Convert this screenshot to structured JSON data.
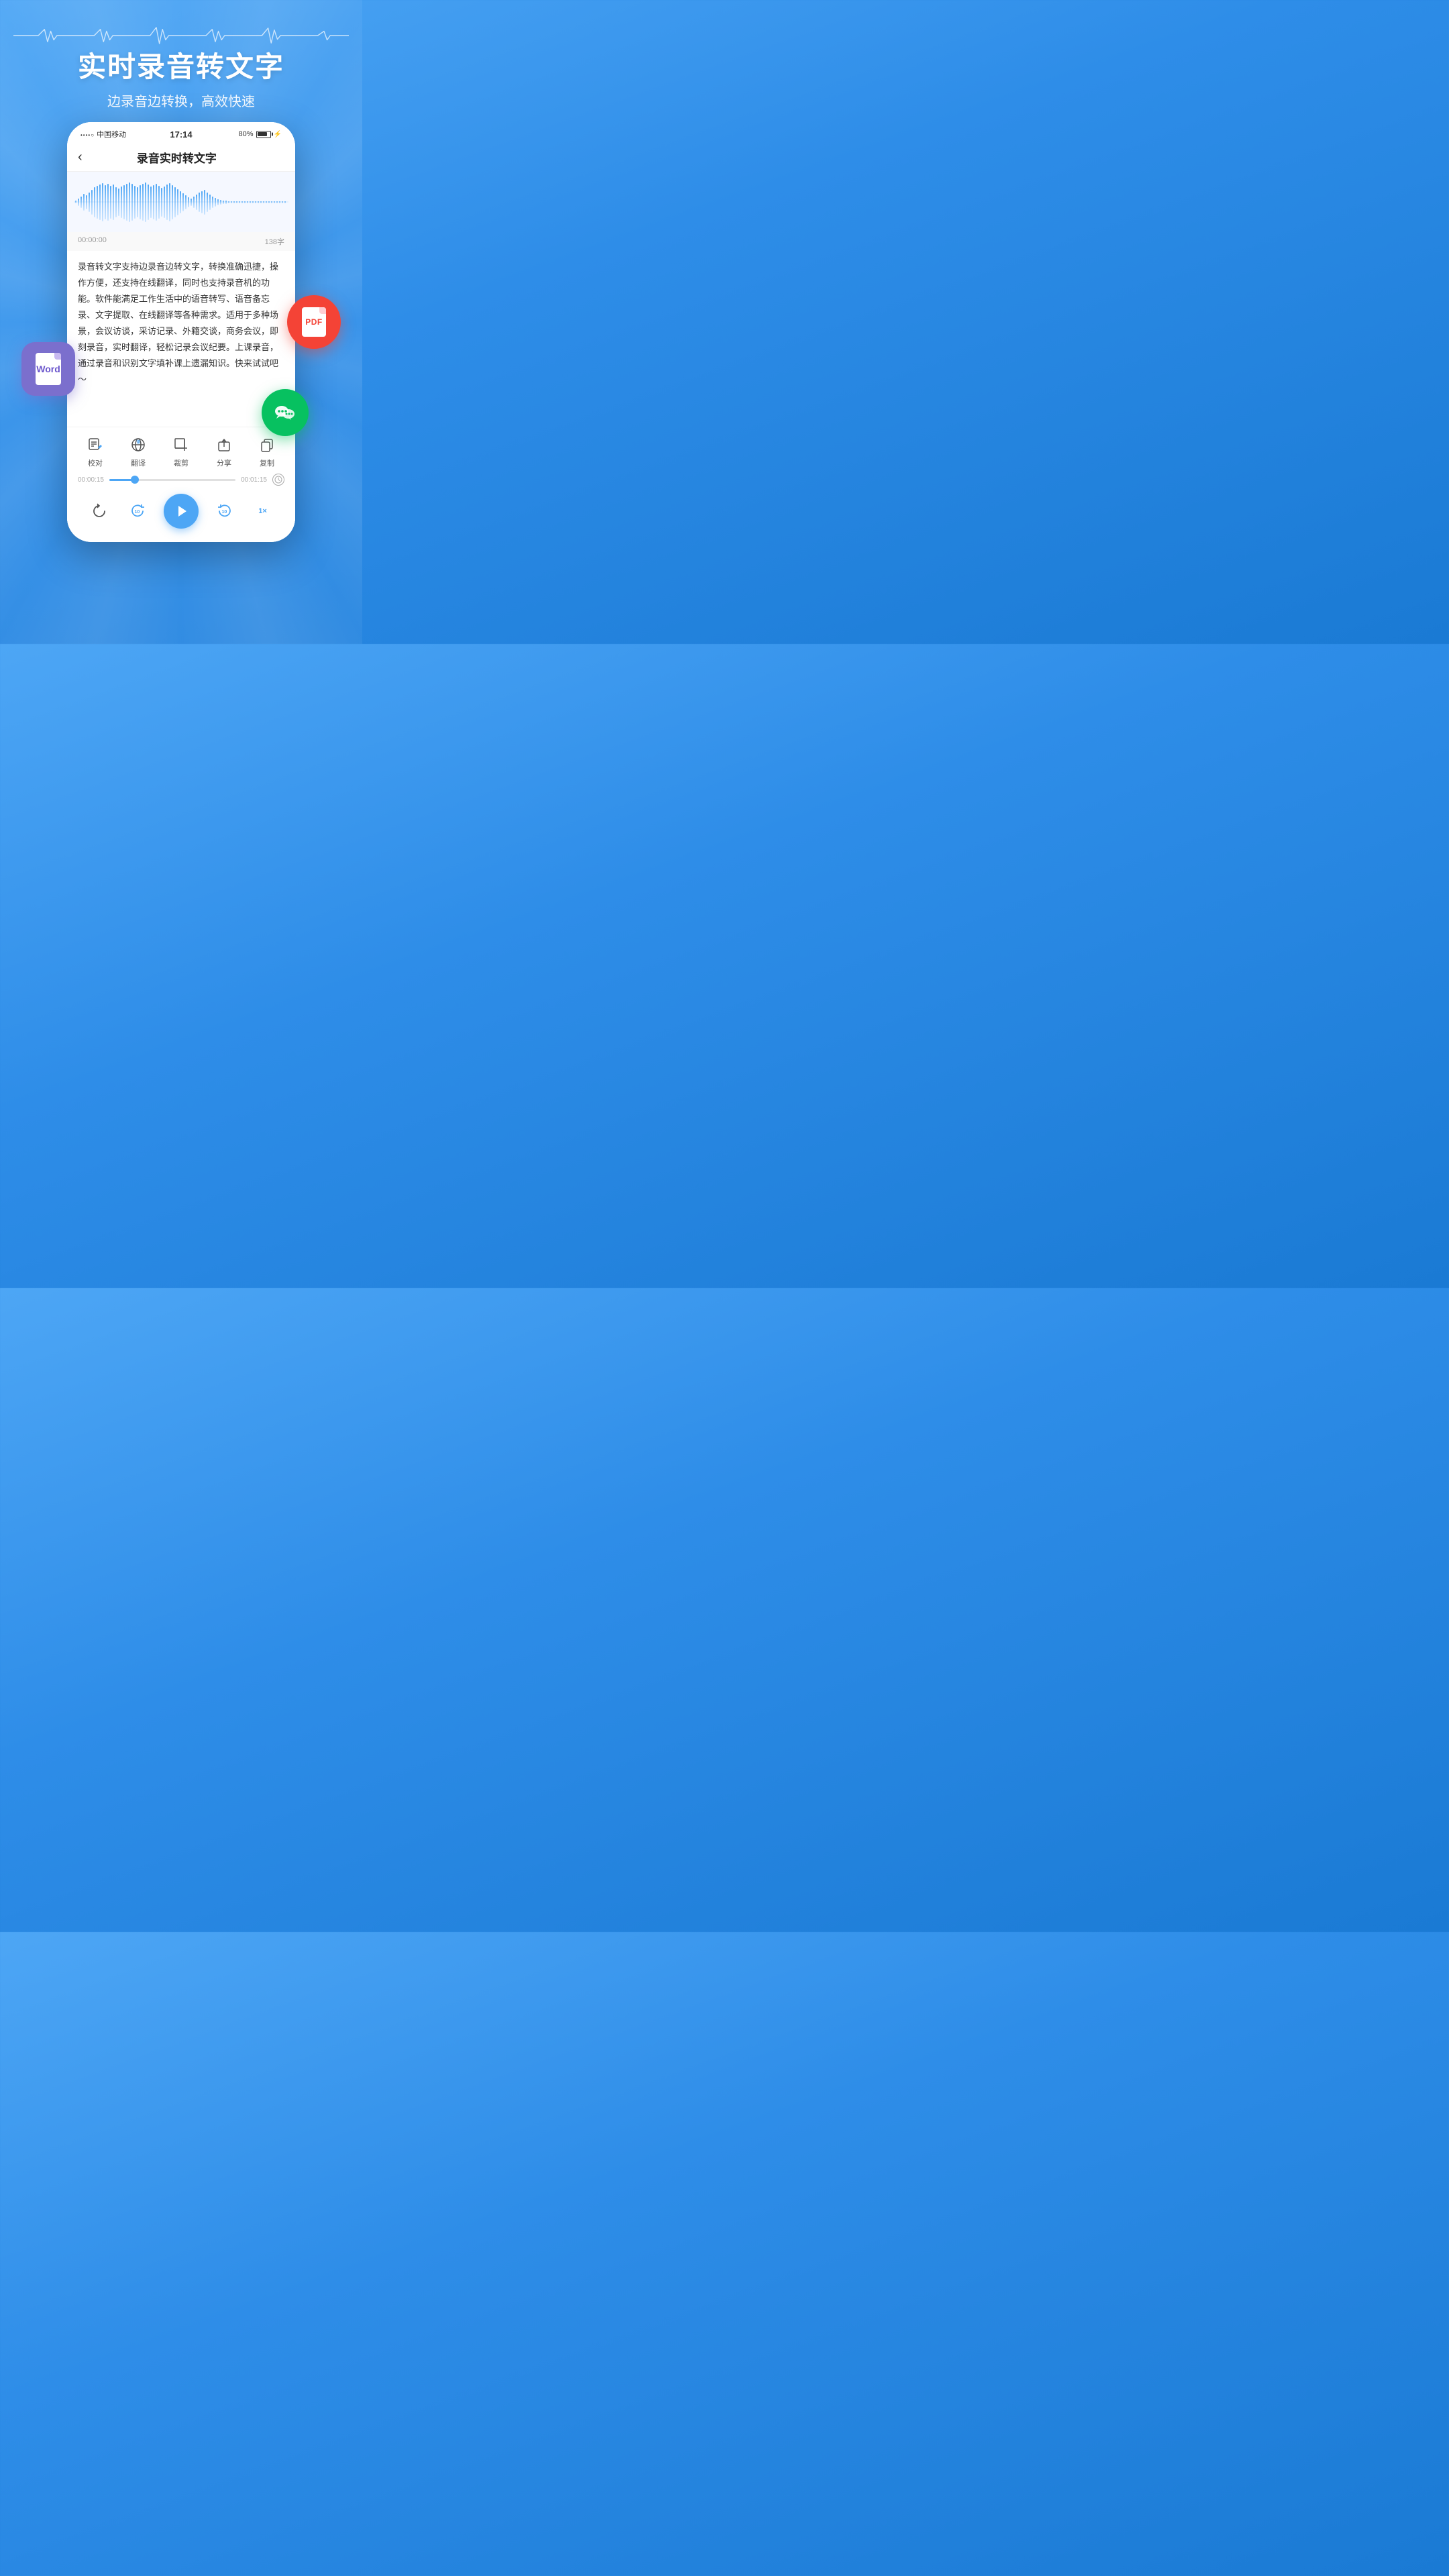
{
  "header": {
    "main_title": "实时录音转文字",
    "sub_title": "边录音边转换，高效快速"
  },
  "phone": {
    "status_bar": {
      "carrier": "中国移动",
      "time": "17:14",
      "battery": "80%"
    },
    "nav_title": "录音实时转文字",
    "back_label": "‹",
    "timer_start": "00:00:00",
    "char_count": "138字",
    "text_body": "录音转文字支持边录音边转文字，转换准确迅捷，操作方便，还支持在线翻译，同时也支持录音机的功能。软件能满足工作生活中的语音转写、语音备忘录、文字提取、在线翻译等各种需求。适用于多种场景，会议访谈，采访记录、外籍交谈，商务会议，即刻录音，实时翻译，轻松记录会议纪要。上课录音，通过录音和识别文字填补课上遗漏知识。快来试试吧～",
    "toolbar": {
      "items": [
        {
          "label": "校对",
          "icon": "edit-icon"
        },
        {
          "label": "翻译",
          "icon": "translate-icon"
        },
        {
          "label": "裁剪",
          "icon": "crop-icon"
        },
        {
          "label": "分享",
          "icon": "share-icon"
        },
        {
          "label": "复制",
          "icon": "copy-icon"
        }
      ]
    },
    "progress": {
      "current": "00:00:15",
      "total": "00:01:15",
      "percent": 20
    },
    "controls": {
      "rewind_label": "replay-icon",
      "back10_label": "10s",
      "play_label": "play-icon",
      "forward10_label": "10s",
      "speed_label": "1×"
    }
  },
  "float_badges": {
    "word_label": "Word",
    "pdf_label": "PDF"
  }
}
